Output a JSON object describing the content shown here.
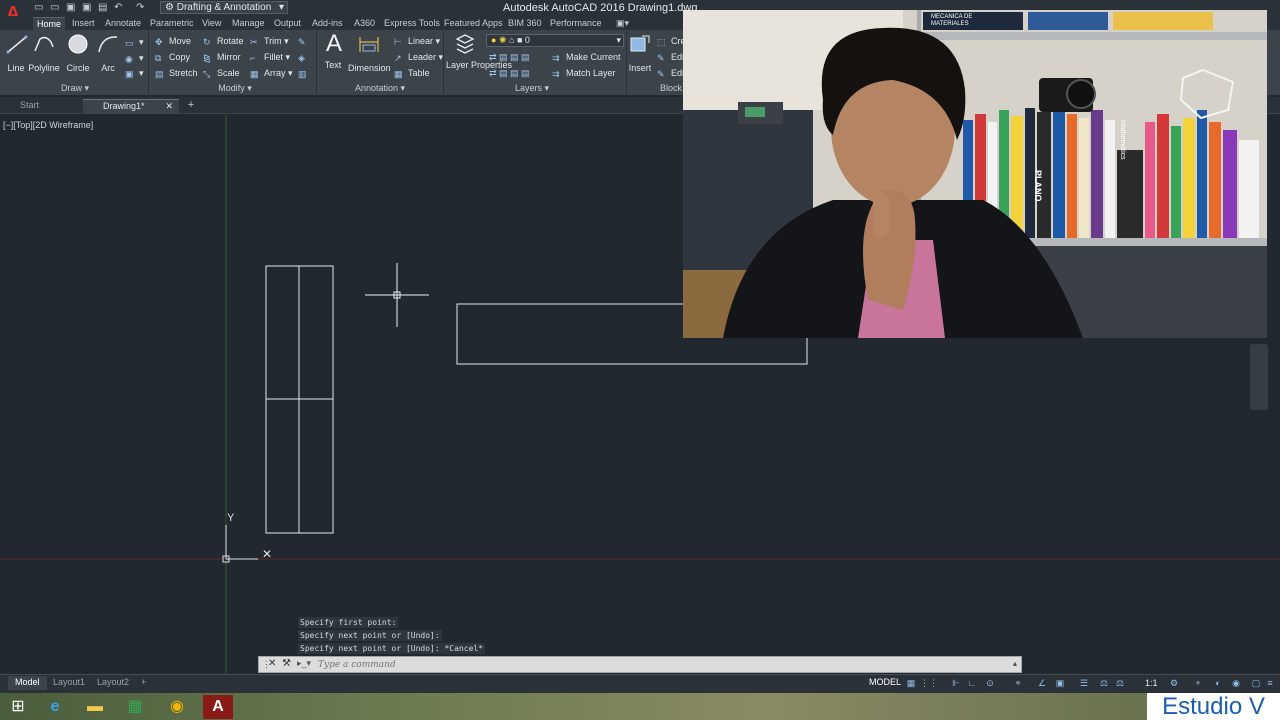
{
  "app": {
    "title": "Autodesk AutoCAD 2016    Drawing1.dwg",
    "workspace": "Drafting & Annotation",
    "logo_letter": "A"
  },
  "ribbon_tabs": [
    "Home",
    "Insert",
    "Annotate",
    "Parametric",
    "View",
    "Manage",
    "Output",
    "Add-ins",
    "A360",
    "Express Tools",
    "Featured Apps",
    "BIM 360",
    "Performance"
  ],
  "draw_panel": {
    "title": "Draw",
    "tools": [
      "Line",
      "Polyline",
      "Circle",
      "Arc"
    ]
  },
  "modify_panel": {
    "title": "Modify",
    "row1": [
      "Move",
      "Rotate",
      "Trim"
    ],
    "row2": [
      "Copy",
      "Mirror",
      "Fillet"
    ],
    "row3": [
      "Stretch",
      "Scale",
      "Array"
    ]
  },
  "annotation_panel": {
    "title": "Annotation",
    "text": "Text",
    "dimension": "Dimension",
    "linear": "Linear",
    "leader": "Leader",
    "table": "Table"
  },
  "layers_panel": {
    "title": "Layers",
    "layer_properties": "Layer Properties",
    "current_layer": "0",
    "make_current": "Make Current",
    "match_layer": "Match Layer"
  },
  "block_panel": {
    "title": "Block",
    "insert": "Insert",
    "create": "Cre",
    "edit1": "Edi",
    "edit2": "Edi"
  },
  "doc_tabs": [
    "Start",
    "Drawing1*"
  ],
  "viewport_label": "[−][Top][2D Wireframe]",
  "ucs": {
    "x_label": "X",
    "y_label": "Y"
  },
  "command_history": [
    "Specify first point:",
    "Specify next point or [Undo]:",
    "Specify next point or [Undo]: *Cancel*"
  ],
  "command_placeholder": "Type a command",
  "layout_tabs": [
    "Model",
    "Layout1",
    "Layout2"
  ],
  "status": {
    "model": "MODEL",
    "scale": "1:1"
  },
  "brand": "Estudio V",
  "webcam": {
    "book_title": "Mathematics",
    "book2": "MECANICA DE MATERIALES",
    "plano": "PLANO"
  },
  "colors": {
    "accent": "#e0302a",
    "canvas": "#212830",
    "ribbon": "#3c434b",
    "brand": "#1a5eb0"
  }
}
